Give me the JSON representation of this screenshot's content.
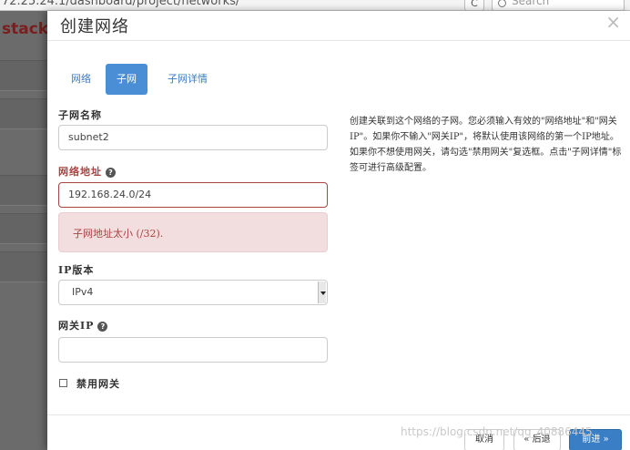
{
  "browser": {
    "url": "72.25.24.1/dashboard/project/networks/",
    "reload_glyph": "C",
    "search_placeholder": "Search"
  },
  "background": {
    "brand_text": "stack"
  },
  "modal": {
    "title": "创建网络",
    "close_glyph": "×",
    "tabs": [
      {
        "label": "网络",
        "active": false
      },
      {
        "label": "子网",
        "active": true
      },
      {
        "label": "子网详情",
        "active": false
      }
    ],
    "subnet_name": {
      "label": "子网名称",
      "value": "subnet2"
    },
    "network_address": {
      "label": "网络地址",
      "help_glyph": "?",
      "value": "192.168.24.0/24",
      "error": "子网地址太小 (/32)."
    },
    "ip_version": {
      "label": "IP版本",
      "selected": "IPv4"
    },
    "gateway_ip": {
      "label": "网关IP",
      "help_glyph": "?",
      "value": ""
    },
    "disable_gateway": {
      "label": "禁用网关",
      "checked": false
    },
    "description": "创建关联到这个网络的子网。您必须输入有效的\"网络地址\"和\"网关IP\"。如果你不输入\"网关IP\"，将默认使用该网络的第一个IP地址。如果你不想使用网关，请勾选\"禁用网关\"复选框。点击\"子网详情\"标签可进行高级配置。",
    "buttons": {
      "cancel": "取消",
      "back": "« 后退",
      "next": "前进 »"
    }
  },
  "watermark": "https://blog.csdn.net/qq_40886445",
  "colors": {
    "accent": "#4a8fd6",
    "error": "#a94442",
    "error_bg": "#f2dede"
  }
}
